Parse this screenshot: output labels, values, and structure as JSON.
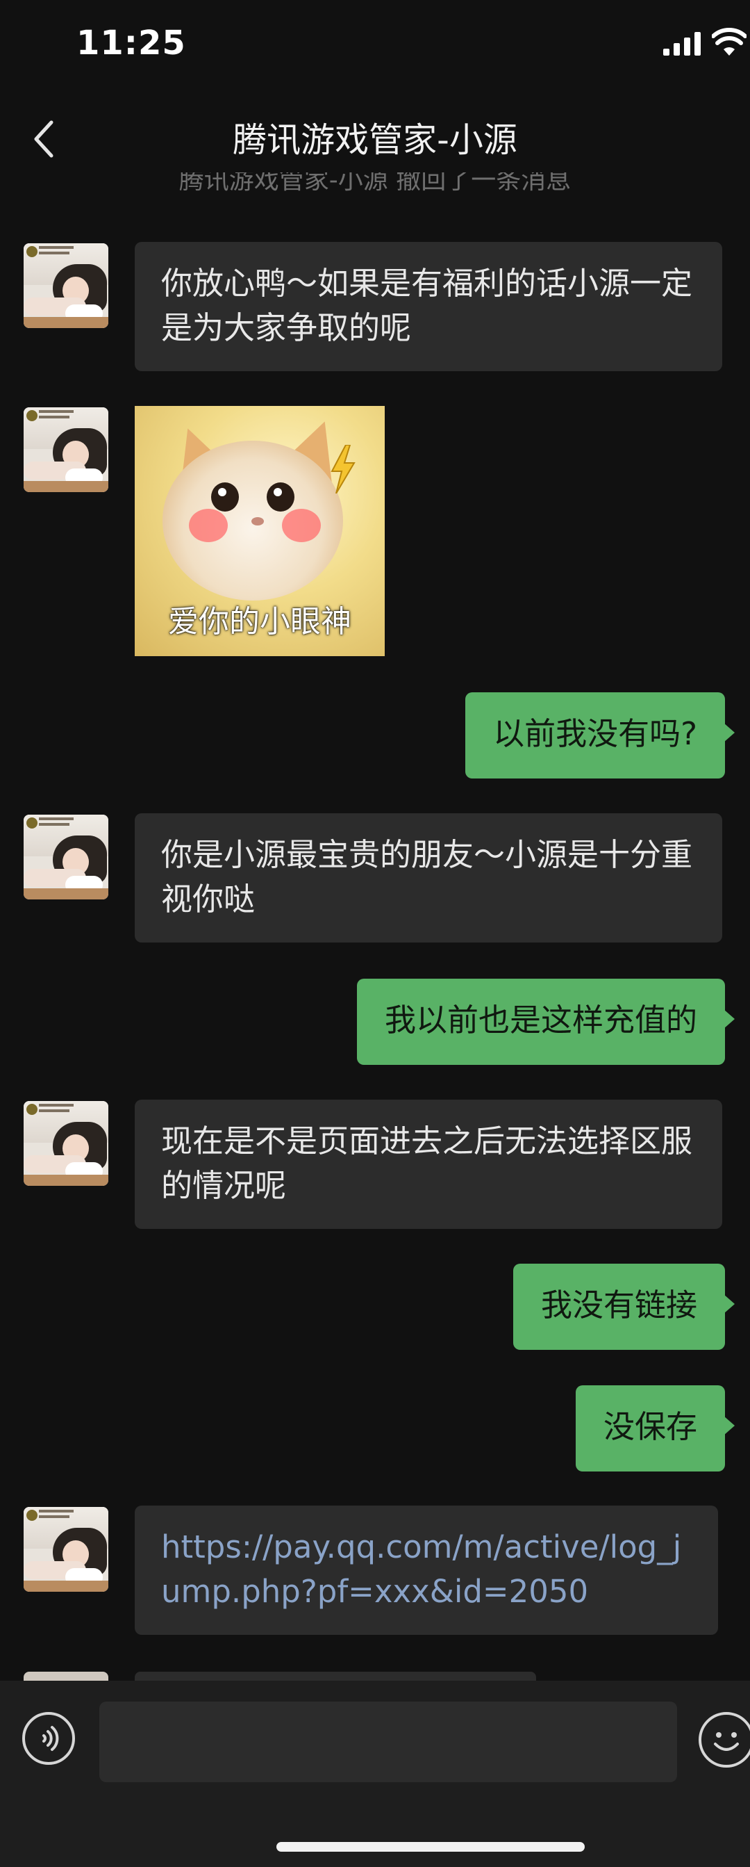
{
  "status_bar": {
    "time": "11:25"
  },
  "header": {
    "title": "腾讯游戏管家-小源",
    "recall_notice": "腾讯游戏管家-小源 撤回了一条消息"
  },
  "messages": [
    {
      "side": "left",
      "type": "text",
      "text": "你放心鸭～如果是有福利的话小源一定是为大家争取的呢"
    },
    {
      "side": "left",
      "type": "sticker",
      "caption": "爱你的小眼神"
    },
    {
      "side": "right",
      "type": "text",
      "text": "以前我没有吗?"
    },
    {
      "side": "left",
      "type": "text",
      "text": "你是小源最宝贵的朋友～小源是十分重视你哒"
    },
    {
      "side": "right",
      "type": "text",
      "text": "我以前也是这样充值的"
    },
    {
      "side": "left",
      "type": "text",
      "text": "现在是不是页面进去之后无法选择区服的情况呢"
    },
    {
      "side": "right",
      "type": "text",
      "text": "我没有链接"
    },
    {
      "side": "right",
      "type": "text",
      "text": "没保存"
    },
    {
      "side": "left",
      "type": "link",
      "text": "https://pay.qq.com/m/active/log_jump.php?pf=xxx&id=2050"
    }
  ],
  "composer": {
    "input_value": ""
  },
  "icons": {
    "back": "chevron-left-icon",
    "voice": "voice-icon",
    "emoji": "emoji-icon",
    "signal": "signal-icon",
    "wifi": "wifi-icon"
  },
  "colors": {
    "background": "#111111",
    "incoming_bubble": "#2c2c2c",
    "outgoing_bubble": "#59b266",
    "link": "#8aa3c8"
  }
}
